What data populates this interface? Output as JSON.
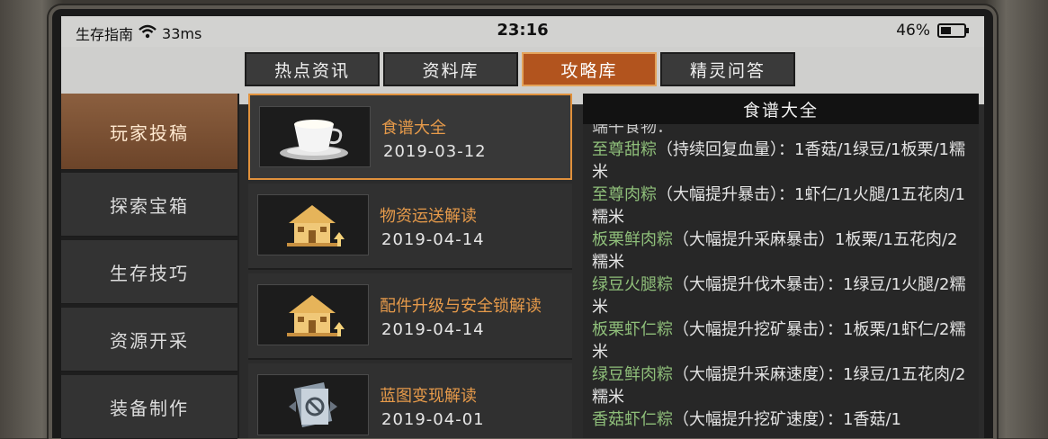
{
  "status_bar": {
    "app_label": "生存指南",
    "ping": "33ms",
    "time": "23:16",
    "battery": "46%",
    "battery_level": 0.46
  },
  "tabs": [
    {
      "label": "热点资讯",
      "active": false
    },
    {
      "label": "资料库",
      "active": false
    },
    {
      "label": "攻略库",
      "active": true
    },
    {
      "label": "精灵问答",
      "active": false
    }
  ],
  "sidebar": {
    "items": [
      {
        "label": "玩家投稿",
        "active": true
      },
      {
        "label": "探索宝箱",
        "active": false
      },
      {
        "label": "生存技巧",
        "active": false
      },
      {
        "label": "资源开采",
        "active": false
      },
      {
        "label": "装备制作",
        "active": false
      }
    ]
  },
  "articles": [
    {
      "title": "食谱大全",
      "date": "2019-03-12",
      "icon": "teacup-icon",
      "active": true
    },
    {
      "title": "物资运送解读",
      "date": "2019-04-14",
      "icon": "house-upgrade-icon",
      "active": false
    },
    {
      "title": "配件升级与安全锁解读",
      "date": "2019-04-14",
      "icon": "house-upgrade-icon",
      "active": false
    },
    {
      "title": "蓝图变现解读",
      "date": "2019-04-01",
      "icon": "blueprint-icon",
      "active": false
    }
  ],
  "detail": {
    "title": "食谱大全",
    "intro": "端午食物：",
    "entries": [
      {
        "name": "至尊甜粽",
        "desc": "（持续回复血量）：1香菇/1绿豆/1板栗/1糯米"
      },
      {
        "name": "至尊肉粽",
        "desc": "（大幅提升暴击）：1虾仁/1火腿/1五花肉/1糯米"
      },
      {
        "name": "板栗鲜肉粽",
        "desc": "（大幅提升采麻暴击）1板栗/1五花肉/2糯米"
      },
      {
        "name": "绿豆火腿粽",
        "desc": "（大幅提升伐木暴击）：1绿豆/1火腿/2糯米"
      },
      {
        "name": "板栗虾仁粽",
        "desc": "（大幅提升挖矿暴击）：1板栗/1虾仁/2糯米"
      },
      {
        "name": "绿豆鲜肉粽",
        "desc": "（大幅提升采麻速度）：1绿豆/1五花肉/2糯米"
      },
      {
        "name": "香菇虾仁粽",
        "desc": "（大幅提升挖矿速度）：1香菇/1"
      }
    ]
  },
  "colors": {
    "accent": "#b2541e",
    "highlight_border": "#e1913c",
    "article_title": "#e69a4a",
    "recipe_name": "#8fbf7a"
  }
}
